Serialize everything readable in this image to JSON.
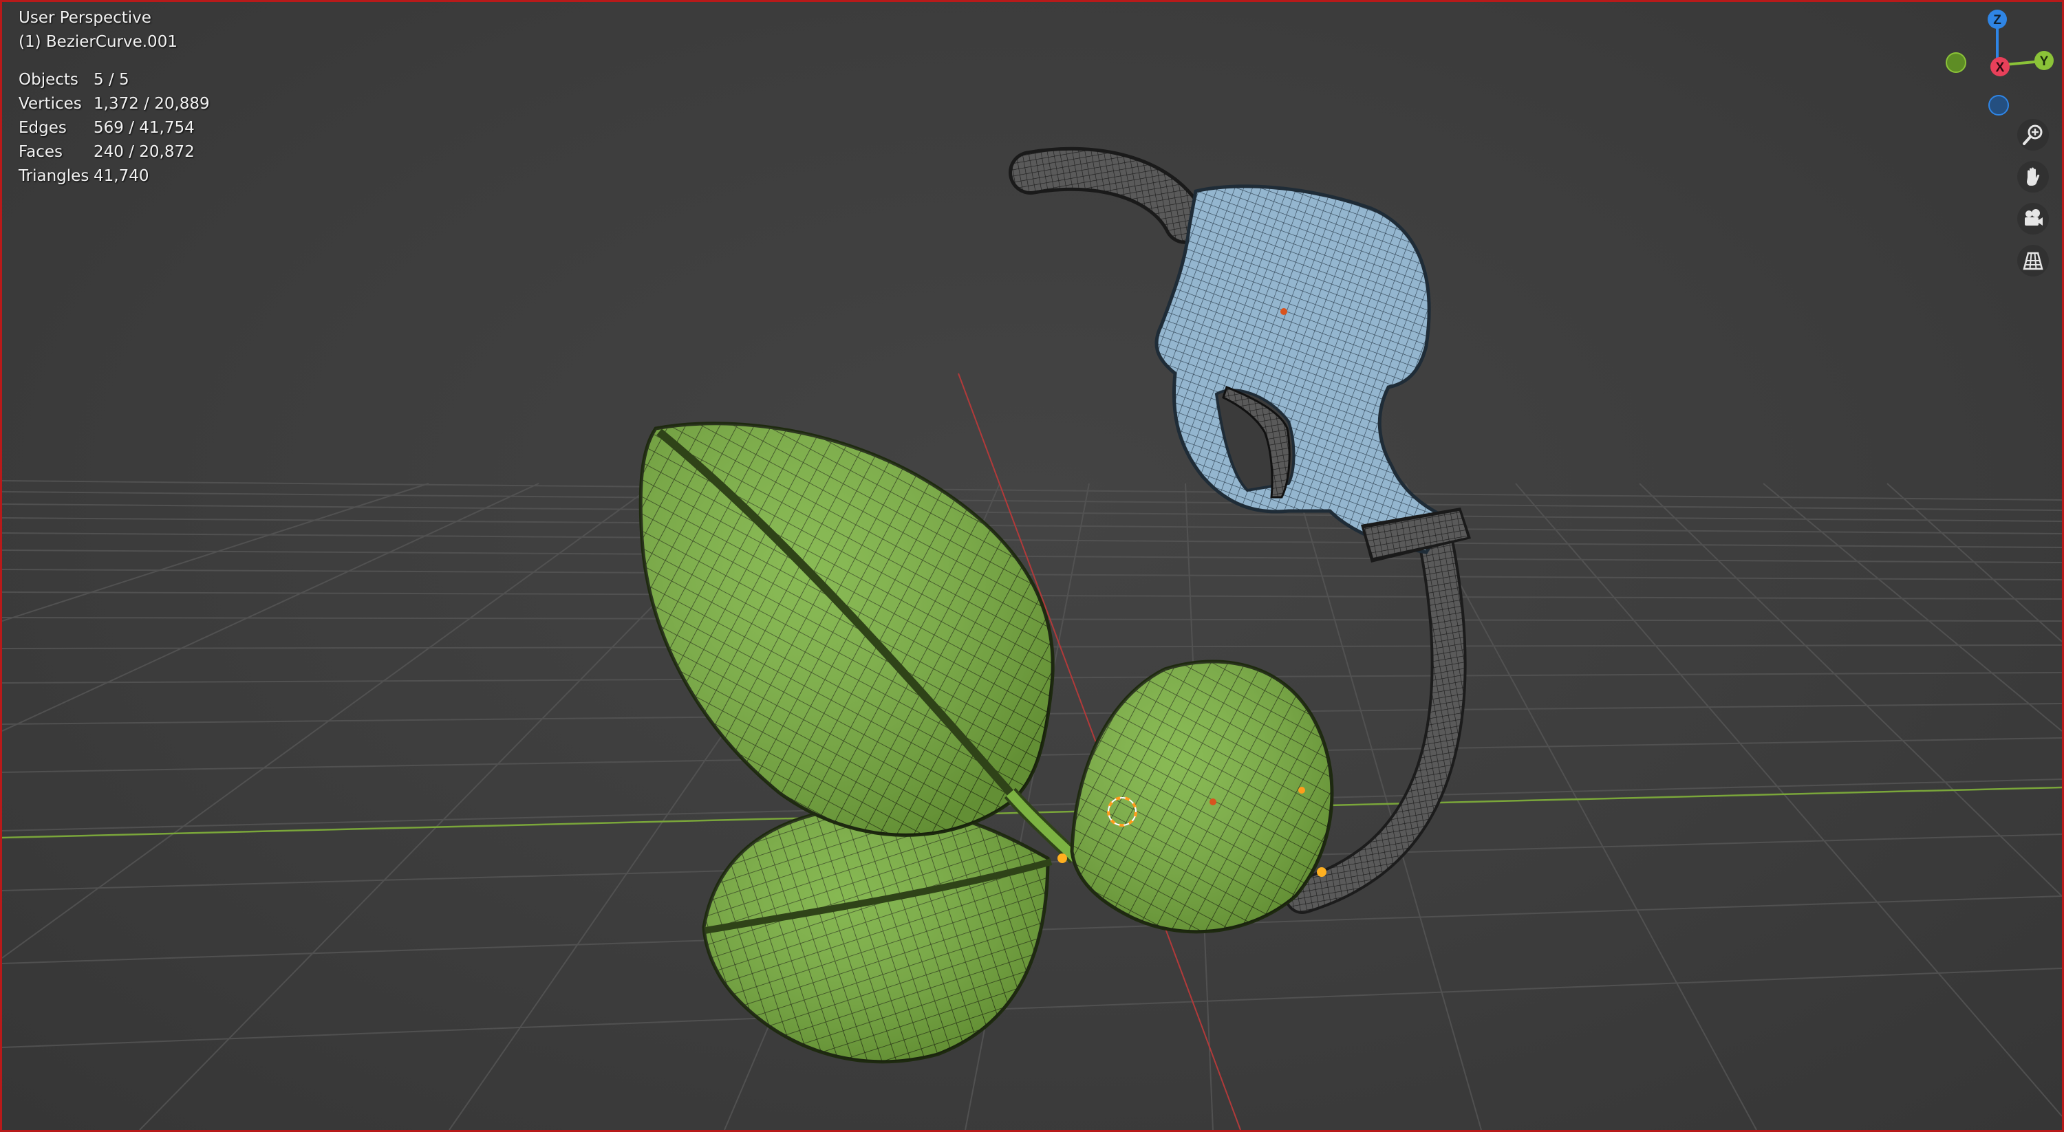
{
  "viewport": {
    "view_name": "User Perspective",
    "active_object": "(1) BezierCurve.001",
    "stats": [
      {
        "label": "Objects",
        "value": "5 / 5"
      },
      {
        "label": "Vertices",
        "value": "1,372 / 20,889"
      },
      {
        "label": "Edges",
        "value": "569 / 41,754"
      },
      {
        "label": "Faces",
        "value": "240 / 20,872"
      },
      {
        "label": "Triangles",
        "value": "41,740"
      }
    ]
  },
  "gizmo": {
    "z_label": "Z",
    "y_label": "Y",
    "x_label": "X",
    "colors": {
      "x": "#e8405a",
      "y": "#8bc338",
      "z": "#2f85e5"
    }
  },
  "tools": [
    {
      "name": "zoom-tool-button",
      "icon": "magnifier-plus-icon"
    },
    {
      "name": "pan-tool-button",
      "icon": "hand-icon"
    },
    {
      "name": "camera-view-button",
      "icon": "camera-icon"
    },
    {
      "name": "perspective-toggle-button",
      "icon": "grid-perspective-icon"
    }
  ],
  "colors": {
    "background": "#3d3d3d",
    "grid": "#555555",
    "leaf_fill": "#7cb342",
    "nozzle_fill": "#8fb2cc",
    "hose_fill": "#4a4a4a",
    "active_outline": "#b81a1a"
  }
}
